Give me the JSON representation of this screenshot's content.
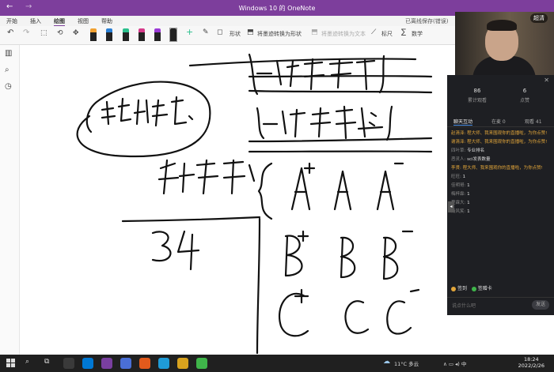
{
  "window": {
    "title": "Windows 10 的 OneNote",
    "back_glyph": "←",
    "forward_glyph": "→"
  },
  "tabs": [
    {
      "label": "开始"
    },
    {
      "label": "插入"
    },
    {
      "label": "绘图"
    },
    {
      "label": "视图"
    },
    {
      "label": "帮助"
    }
  ],
  "save_status": "已离线保存(错误)",
  "ribbon": {
    "undo_glyph": "↶",
    "redo_glyph": "↷",
    "select_glyph": "⬚",
    "lasso_glyph": "⟲",
    "pan_glyph": "✥",
    "add_glyph": "+",
    "shapes_label": "形状",
    "ink_to_shape_label": "将墨迹转换为形状",
    "ink_to_text_label": "将墨迹转换为文本",
    "ruler_label": "标尺",
    "math_label": "数学",
    "pens": [
      {
        "color": "#f0a030"
      },
      {
        "color": "#2a7fd4"
      },
      {
        "color": "#2bbf8c"
      },
      {
        "color": "#d63a8a"
      },
      {
        "color": "#9b3ad6"
      },
      {
        "color": "#3a8fd6"
      },
      {
        "color": "#222222"
      }
    ]
  },
  "sidebar": {
    "notebooks_glyph": "▥",
    "search_glyph": "⌕",
    "recent_glyph": "◷"
  },
  "webcam": {
    "name": "超清"
  },
  "chat": {
    "close_glyph": "✕",
    "stats": [
      {
        "value": "86",
        "label": "累计观看"
      },
      {
        "value": "6",
        "label": "点赞"
      }
    ],
    "tabs": [
      {
        "label": "聊天互动"
      },
      {
        "label": "在麦 0"
      },
      {
        "label": "观看 41"
      }
    ],
    "messages": [
      {
        "user": "赵清泽:",
        "text": "程大师、我来围观你的直播啦，为你点赞!",
        "highlight": true
      },
      {
        "user": "谢清泽:",
        "text": "程大师、我来围观你的直播啦，为你点赞!",
        "highlight": true
      },
      {
        "user": "四叶草:",
        "text": "专业排名",
        "highlight": false
      },
      {
        "user": "恶灵人:",
        "text": "sci发表数量",
        "highlight": false
      },
      {
        "user": "李贤:",
        "text": "程大师、我来围观你的直播啦，为你点赞!",
        "highlight": true
      },
      {
        "user": "旺旺:",
        "text": "1",
        "highlight": false
      },
      {
        "user": "佳明哥:",
        "text": "1",
        "highlight": false
      },
      {
        "user": "梅梓霖:",
        "text": "1",
        "highlight": false
      },
      {
        "user": "夏霖大:",
        "text": "1",
        "highlight": false
      },
      {
        "user": "清风笑:",
        "text": "1",
        "highlight": false
      }
    ],
    "checkin_label": "签到",
    "card_label": "签赠卡",
    "input_placeholder": "说点什么吧",
    "send_label": "发送",
    "collapse_glyph": "◂"
  },
  "taskbar": {
    "weather": "11°C 多云",
    "time": "18:24",
    "date": "2022/2/26",
    "tray_glyphs": "∧ ▭ ◂) 中",
    "app_colors": [
      "#3a3a3a",
      "#0078d4",
      "#7a3fa0",
      "#4a6fd6",
      "#e25a1c",
      "#1f9bd7",
      "#d8a21e",
      "#3fb54a"
    ]
  }
}
